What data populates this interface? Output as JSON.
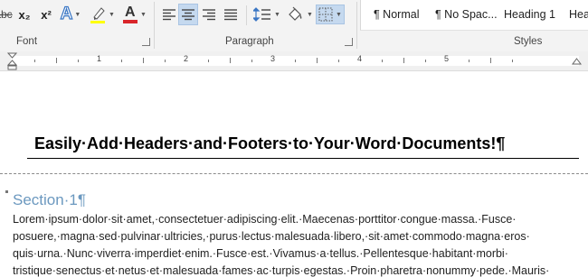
{
  "ribbon": {
    "font_buttons": {
      "strikethrough": "abc",
      "subscript": "x₂",
      "superscript": "x²",
      "text_effects": "A",
      "font_color": "A"
    },
    "groups": {
      "font": "Font",
      "paragraph": "Paragraph",
      "styles": "Styles"
    },
    "styles": [
      "¶ Normal",
      "¶ No Spac...",
      "Heading 1",
      "Hea"
    ],
    "colors": {
      "highlight": "#ffff00",
      "font_color": "#d9252a",
      "text_effects": "#3a76c4",
      "accent": "#2b579a"
    }
  },
  "ruler": {
    "numbers": [
      "1",
      "2",
      "3",
      "4",
      "5"
    ]
  },
  "document": {
    "header_text": "Easily·Add·Headers·and·Footers·to·Your·Word·Documents!¶",
    "section_title": "Section·1¶",
    "body_lines": [
      "Lorem·ipsum·dolor·sit·amet,·consectetuer·adipiscing·elit.·Maecenas·porttitor·congue·massa.·Fusce·",
      "posuere,·magna·sed·pulvinar·ultricies,·purus·lectus·malesuada·libero,·sit·amet·commodo·magna·eros·",
      "quis·urna.·Nunc·viverra·imperdiet·enim.·Fusce·est.·Vivamus·a·tellus.·Pellentesque·habitant·morbi·",
      "tristique·senectus·et·netus·et·malesuada·fames·ac·turpis·egestas.·Proin·pharetra·nonummy·pede.·Mauris·"
    ]
  }
}
